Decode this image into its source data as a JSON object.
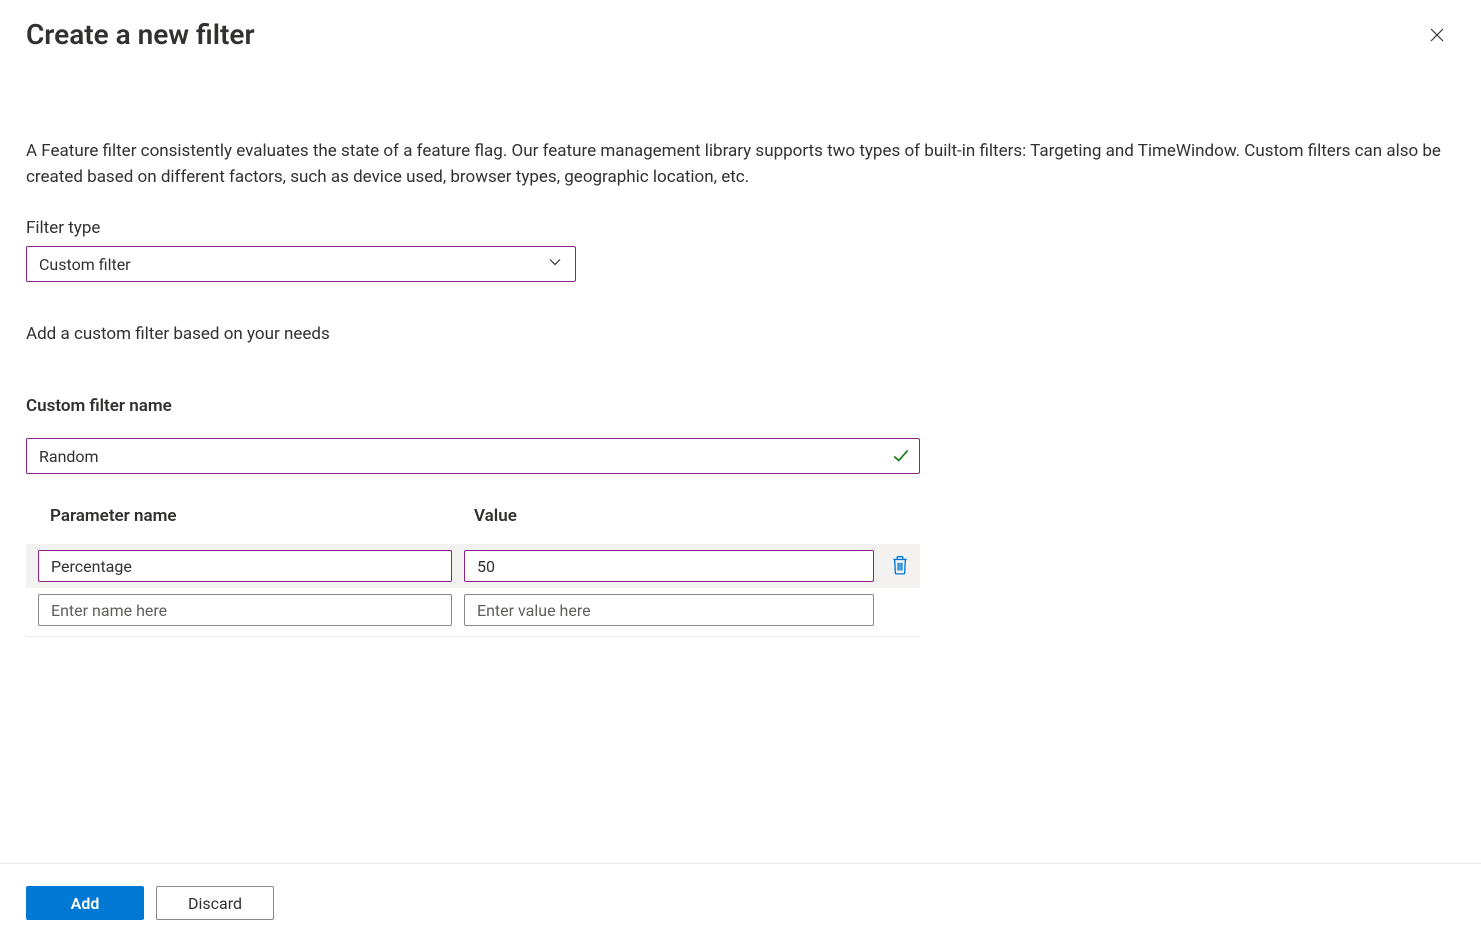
{
  "header": {
    "title": "Create a new filter"
  },
  "description": "A Feature filter consistently evaluates the state of a feature flag. Our feature management library supports two types of built-in filters: Targeting and TimeWindow. Custom filters can also be created based on different factors, such as device used, browser types, geographic location, etc.",
  "filter_type": {
    "label": "Filter type",
    "selected": "Custom filter"
  },
  "helper_text": "Add a custom filter based on your needs",
  "custom_name": {
    "label": "Custom filter name",
    "value": "Random"
  },
  "params": {
    "col_name": "Parameter name",
    "col_value": "Value",
    "rows": [
      {
        "name": "Percentage",
        "value": "50"
      }
    ],
    "placeholder_name": "Enter name here",
    "placeholder_value": "Enter value here"
  },
  "footer": {
    "add": "Add",
    "discard": "Discard"
  }
}
